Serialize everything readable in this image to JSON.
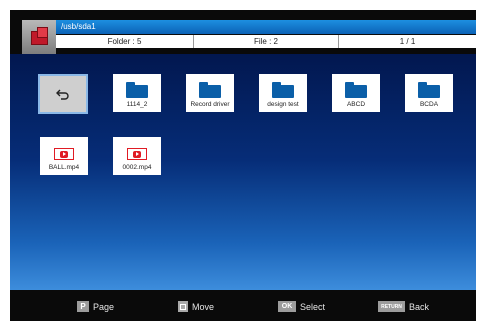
{
  "header": {
    "path": "/usb/sda1",
    "folder_count": "Folder : 5",
    "file_count": "File : 2",
    "page_indicator": "1 / 1"
  },
  "items": [
    {
      "label": "",
      "type": "back",
      "icon": "back-arrow-icon"
    },
    {
      "label": "1114_2",
      "type": "folder",
      "icon": "folder-icon"
    },
    {
      "label": "Record driver",
      "type": "folder",
      "icon": "folder-icon"
    },
    {
      "label": "design test",
      "type": "folder",
      "icon": "folder-icon"
    },
    {
      "label": "ABCD",
      "type": "folder",
      "icon": "folder-icon"
    },
    {
      "label": "BCDA",
      "type": "folder",
      "icon": "folder-icon"
    },
    {
      "label": "BALL.mp4",
      "type": "video",
      "icon": "video-file-icon"
    },
    {
      "label": "0002.mp4",
      "type": "video",
      "icon": "video-file-icon"
    }
  ],
  "footer": {
    "page": {
      "key": "P",
      "label": "Page"
    },
    "move": {
      "key": "",
      "label": "Move"
    },
    "select": {
      "key": "OK",
      "label": "Select"
    },
    "back": {
      "key": "RETURN",
      "label": "Back"
    }
  },
  "colors": {
    "accent_blue": "#0b62b6",
    "folder_blue": "#0b5fa8",
    "video_red": "#e01b24",
    "selection_border": "#8ab8e8"
  }
}
